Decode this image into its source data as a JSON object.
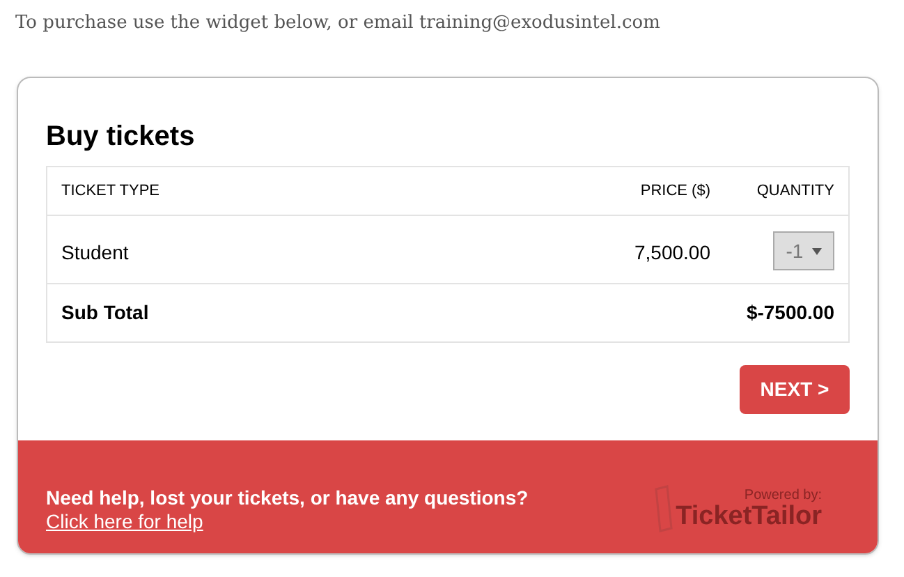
{
  "intro": "To purchase use the widget below, or email training@exodusintel.com",
  "title": "Buy tickets",
  "table": {
    "columns": [
      "TICKET TYPE",
      "PRICE ($)",
      "QUANTITY"
    ],
    "rows": [
      {
        "ticket_type": "Student",
        "price": "7,500.00",
        "quantity": "-1",
        "disabled": true
      }
    ],
    "subtotal": {
      "label": "Sub Total",
      "value": "$-7500.00"
    }
  },
  "next_button": "NEXT >",
  "footer": {
    "question": "Need help, lost your tickets, or have any questions?",
    "link": "Click here for help",
    "powered_by": "Powered by:",
    "brand": "TicketTailor"
  }
}
